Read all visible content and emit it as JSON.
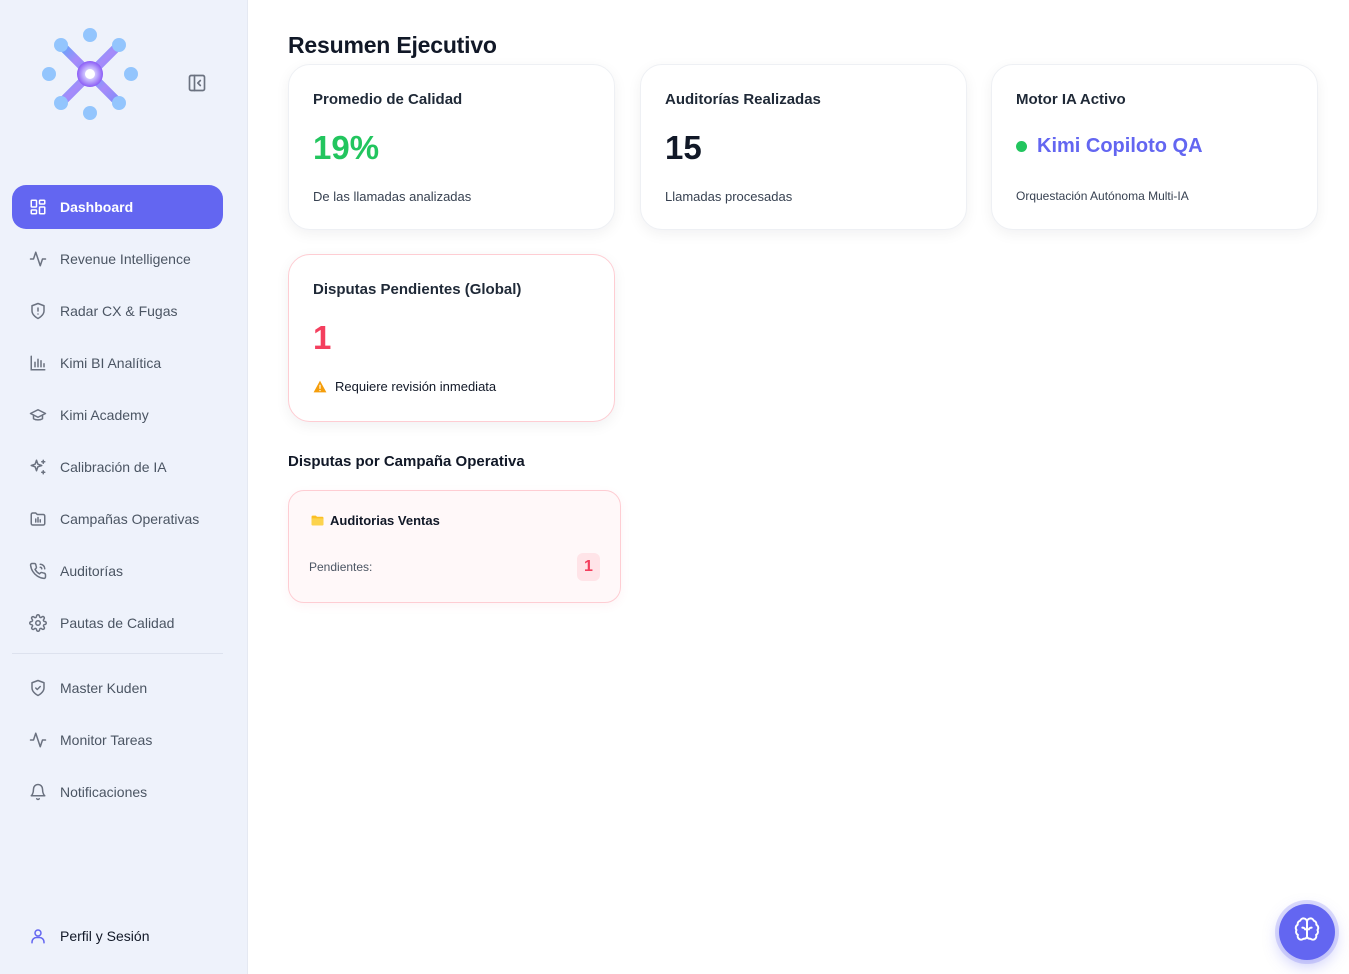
{
  "sidebar": {
    "collapse_icon": "sidebar-collapse-icon",
    "items": [
      {
        "label": "Dashboard",
        "icon": "layout-grid-icon",
        "active": true
      },
      {
        "label": "Revenue Intelligence",
        "icon": "activity-icon"
      },
      {
        "label": "Radar CX & Fugas",
        "icon": "shield-alert-icon"
      },
      {
        "label": "Kimi BI Analítica",
        "icon": "bar-chart-icon"
      },
      {
        "label": "Kimi Academy",
        "icon": "graduation-cap-icon"
      },
      {
        "label": "Calibración de IA",
        "icon": "sparkles-icon"
      },
      {
        "label": "Campañas Operativas",
        "icon": "folder-chart-icon"
      },
      {
        "label": "Auditorías",
        "icon": "phone-call-icon"
      },
      {
        "label": "Pautas de Calidad",
        "icon": "settings-icon"
      }
    ],
    "secondary_items": [
      {
        "label": "Master Kuden",
        "icon": "shield-check-icon"
      },
      {
        "label": "Monitor Tareas",
        "icon": "activity-icon"
      },
      {
        "label": "Notificaciones",
        "icon": "bell-icon"
      }
    ],
    "profile": {
      "label": "Perfil y Sesión",
      "icon": "user-icon"
    }
  },
  "main": {
    "title": "Resumen Ejecutivo",
    "cards": {
      "quality": {
        "title": "Promedio de Calidad",
        "value": "19%",
        "subtitle": "De las llamadas analizadas"
      },
      "audits": {
        "title": "Auditorías Realizadas",
        "value": "15",
        "subtitle": "Llamadas procesadas"
      },
      "engine": {
        "title": "Motor IA Activo",
        "value": "Kimi Copiloto QA",
        "subtitle": "Orquestación Autónoma Multi-IA"
      },
      "disputes": {
        "title": "Disputas Pendientes (Global)",
        "value": "1",
        "subtitle": "Requiere revisión inmediata",
        "icon": "warning-icon"
      }
    },
    "campaigns_section": {
      "title": "Disputas por Campaña Operativa",
      "items": [
        {
          "name": "Auditorias Ventas",
          "icon": "folder-icon",
          "pending_label": "Pendientes:",
          "pending_count": "1"
        }
      ]
    },
    "fab_icon": "brain-icon"
  },
  "colors": {
    "accent": "#6366f1",
    "sidebar_bg": "#eef2fb",
    "success": "#22c55e",
    "danger": "#f43f5e",
    "warning": "#f59e0b"
  }
}
